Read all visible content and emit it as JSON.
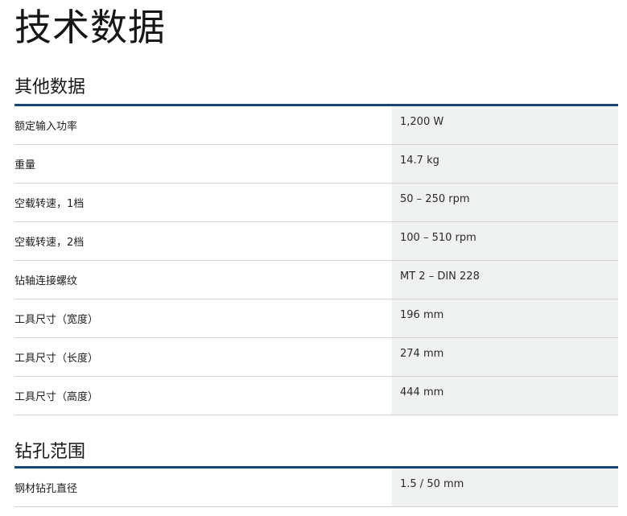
{
  "page": {
    "title": "技术数据"
  },
  "sections": [
    {
      "title": "其他数据",
      "rows": [
        {
          "label": "额定输入功率",
          "value": "1,200 W"
        },
        {
          "label": "重量",
          "value": "14.7 kg"
        },
        {
          "label": "空载转速，1档",
          "value": "50 – 250 rpm"
        },
        {
          "label": "空载转速，2档",
          "value": "100 – 510 rpm"
        },
        {
          "label": "钻轴连接螺纹",
          "value": "MT 2 – DIN 228"
        },
        {
          "label": "工具尺寸（宽度）",
          "value": "196 mm"
        },
        {
          "label": "工具尺寸（长度）",
          "value": "274 mm"
        },
        {
          "label": "工具尺寸（高度）",
          "value": "444 mm"
        }
      ]
    },
    {
      "title": "钻孔范围",
      "rows": [
        {
          "label": "钢材钻孔直径",
          "value": "1.5 / 50 mm"
        }
      ]
    }
  ],
  "colors": {
    "section_rule": "#17457a",
    "value_background": "#eff1f1",
    "row_divider": "#d4d4d4",
    "text": "#1f1f1f"
  }
}
